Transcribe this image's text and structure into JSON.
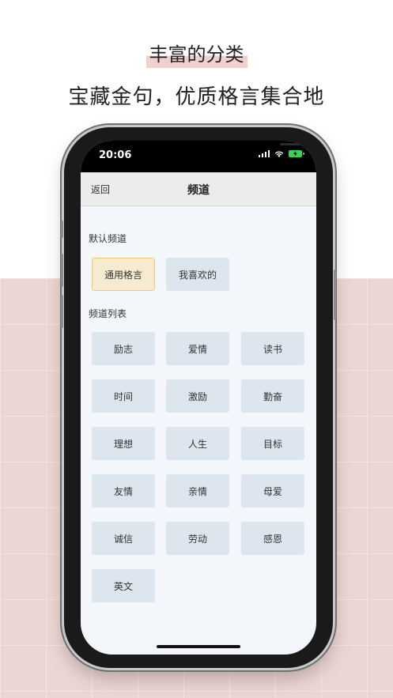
{
  "headline": {
    "title": "丰富的分类",
    "subtitle": "宝藏金句，优质格言集合地"
  },
  "status_bar": {
    "time": "20:06",
    "icons": [
      "signal-icon",
      "wifi-icon",
      "battery-charging-icon"
    ]
  },
  "navbar": {
    "back_label": "返回",
    "title": "频道"
  },
  "default_section": {
    "label": "默认频道",
    "items": [
      {
        "label": "通用格言",
        "selected": true
      },
      {
        "label": "我喜欢的",
        "selected": false
      }
    ]
  },
  "list_section": {
    "label": "频道列表",
    "items": [
      {
        "label": "励志"
      },
      {
        "label": "爱情"
      },
      {
        "label": "读书"
      },
      {
        "label": "时间"
      },
      {
        "label": "激励"
      },
      {
        "label": "勤奋"
      },
      {
        "label": "理想"
      },
      {
        "label": "人生"
      },
      {
        "label": "目标"
      },
      {
        "label": "友情"
      },
      {
        "label": "亲情"
      },
      {
        "label": "母爱"
      },
      {
        "label": "诚信"
      },
      {
        "label": "劳动"
      },
      {
        "label": "感恩"
      },
      {
        "label": "英文"
      }
    ]
  },
  "colors": {
    "accent_border": "#f0cb6b",
    "accent_fill": "#f6ead0",
    "chip_fill": "#dde5ee",
    "backdrop_pink": "#ecd6d3"
  }
}
